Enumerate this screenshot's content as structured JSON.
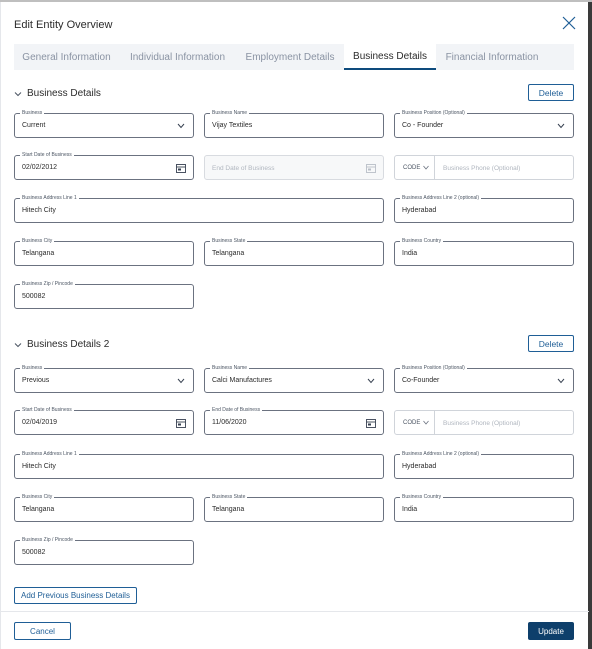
{
  "modal": {
    "title": "Edit Entity Overview"
  },
  "tabs": [
    {
      "label": "General Information"
    },
    {
      "label": "Individual Information"
    },
    {
      "label": "Employment Details"
    },
    {
      "label": "Business Details",
      "active": true
    },
    {
      "label": "Financial Information"
    }
  ],
  "sections": [
    {
      "title": "Business Details",
      "delete_label": "Delete",
      "business": {
        "label": "Business",
        "value": "Current"
      },
      "business_name": {
        "label": "Business Name",
        "value": "Vijay Textiles"
      },
      "position": {
        "label": "Business Position (Optional)",
        "value": "Co - Founder"
      },
      "start_date": {
        "label": "Start Date of Business",
        "value": "02/02/2012"
      },
      "end_date": {
        "label": "",
        "placeholder": "End Date of Business"
      },
      "phone": {
        "code": "CODE",
        "placeholder": "Business Phone (Optional)"
      },
      "address1": {
        "label": "Business Address Line 1",
        "value": "Hitech City"
      },
      "address2": {
        "label": "Business Address Line 2 (optional)",
        "value": "Hyderabad"
      },
      "city": {
        "label": "Business City",
        "value": "Telangana"
      },
      "state": {
        "label": "Business State",
        "value": "Telangana"
      },
      "country": {
        "label": "Business Country",
        "value": "India"
      },
      "zip": {
        "label": "Business Zip / Pincode",
        "value": "500082"
      }
    },
    {
      "title": "Business Details 2",
      "delete_label": "Delete",
      "business": {
        "label": "Business",
        "value": "Previous"
      },
      "business_name": {
        "label": "Business Name",
        "value": "Calci Manufactures"
      },
      "position": {
        "label": "Business Position (Optional)",
        "value": "Co-Founder"
      },
      "start_date": {
        "label": "Start Date of Business",
        "value": "02/04/2019"
      },
      "end_date": {
        "label": "End Date of Business",
        "value": "11/06/2020"
      },
      "phone": {
        "code": "CODE",
        "placeholder": "Business Phone (Optional)"
      },
      "address1": {
        "label": "Business Address Line 1",
        "value": "Hitech City"
      },
      "address2": {
        "label": "Business Address Line 2 (optional)",
        "value": "Hyderabad"
      },
      "city": {
        "label": "Business City",
        "value": "Telangana"
      },
      "state": {
        "label": "Business State",
        "value": "Telangana"
      },
      "country": {
        "label": "Business Country",
        "value": "India"
      },
      "zip": {
        "label": "Business Zip / Pincode",
        "value": "500082"
      }
    }
  ],
  "actions": {
    "add_previous": "Add Previous Business Details",
    "cancel": "Cancel",
    "update": "Update"
  },
  "colors": {
    "primary": "#0e3f6b",
    "accent": "#1f5e96",
    "tab_active_border": "#0e4b7d"
  },
  "icons": {
    "close": "close-icon",
    "chevron": "chevron-down-icon",
    "calendar": "calendar-icon"
  }
}
